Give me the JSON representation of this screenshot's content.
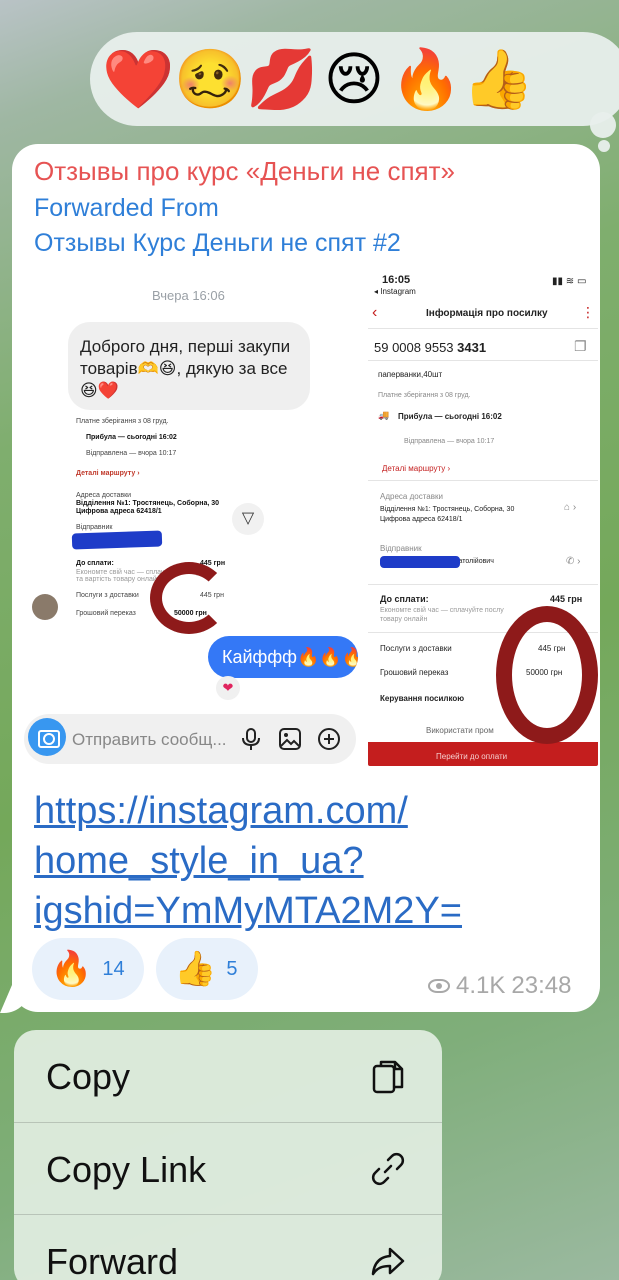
{
  "reactions_bar": {
    "emojis": [
      "❤️",
      "🥴",
      "💋",
      "😢",
      "🔥",
      "👍"
    ]
  },
  "message": {
    "channel_name": "Отзывы про курс «Деньги не спят»",
    "forwarded_label": "Forwarded From",
    "forwarded_source": "Отзывы Курс Деньги не спят #2",
    "link_lines": [
      "https://instagram.com/",
      "home_style_in_ua?",
      "igshid=YmMyMTA2M2Y="
    ],
    "reactions": [
      {
        "emoji": "🔥",
        "count": "14"
      },
      {
        "emoji": "👍",
        "count": "5"
      }
    ],
    "views": "4.1K",
    "time": "23:48"
  },
  "screenshot_left": {
    "timestamp": "Вчера 16:06",
    "dm_text": "Доброго дня, перші закупи товарів🫶😆, дякую за все 😆❤️",
    "doc_lines": {
      "storage": "Платне зберігання з 08 груд.",
      "arrived": "Прибула — сьогодні 16:02",
      "sent": "Відправлена — вчора 10:17",
      "route": "Деталі маршруту ›",
      "addr_label": "Адреса доставки",
      "addr": "Відділення №1: Тростянець, Соборна, 30",
      "addr2": "Цифрова адреса 62418/1",
      "sender": "Відправник",
      "to_pay": "До сплати:",
      "to_pay_val": "445 грн",
      "save_time": "Економте свій час — сплачуйте послуги",
      "save_time2": "та вартість товару онлайн",
      "delivery": "Послуги з доставки",
      "delivery_val": "445 грн",
      "transfer": "Грошовий переказ",
      "transfer_val": "50000 грн"
    },
    "kaif_text": "Кайффф🔥🔥🔥",
    "heart": "❤",
    "input_placeholder": "Отправить сообщ..."
  },
  "screenshot_right": {
    "status_time": "16:05",
    "status_app": "◂ Instagram",
    "header": "Інформація про посилку",
    "tracking_prefix": "59 0008 9553 ",
    "tracking_bold": "3431",
    "item": "паперванки,40шт",
    "storage": "Платне зберігання з 08 груд.",
    "arrived": "Прибула — сьогодні 16:02",
    "sent": "Відправлена — вчора 10:17",
    "route": "Деталі маршруту ›",
    "addr_label": "Адреса доставки",
    "addr": "Відділення №1: Тростянець, Соборна, 30",
    "addr2": "Цифрова адреса 62418/1",
    "sender_label": "Відправник",
    "sender_name": "Анатолійович",
    "to_pay": "До сплати:",
    "to_pay_val": "445 грн",
    "save_time": "Економте свій час — сплачуйте послу",
    "save_time2": "товару онлайн",
    "delivery": "Послуги з доставки",
    "delivery_val": "445 грн",
    "transfer": "Грошовий переказ",
    "transfer_val": "50000 грн",
    "manage": "Керування посилкою",
    "use_pr": "Використати пром",
    "pay": "Перейти до оплати"
  },
  "context_menu": {
    "items": [
      {
        "label": "Copy",
        "icon": "copy-icon"
      },
      {
        "label": "Copy Link",
        "icon": "link-icon"
      },
      {
        "label": "Forward",
        "icon": "forward-icon"
      }
    ]
  }
}
